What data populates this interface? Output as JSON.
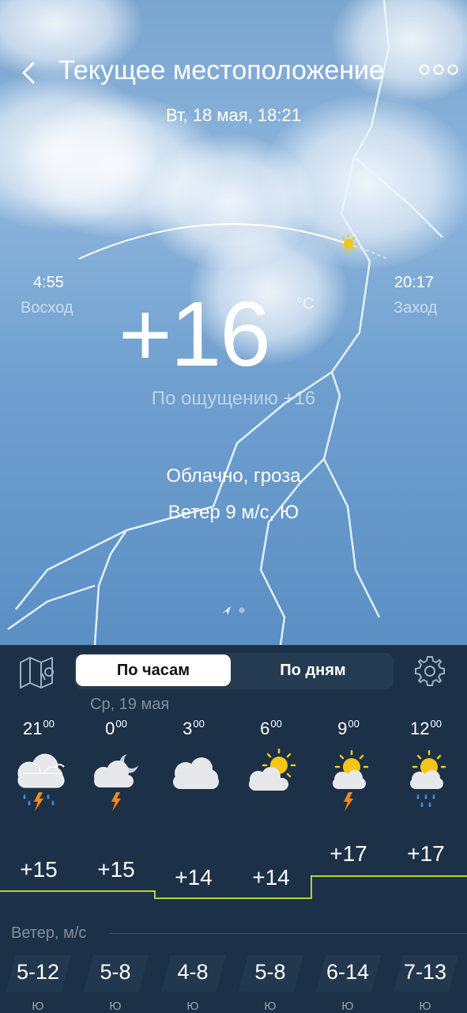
{
  "header": {
    "title": "Текущее местоположение",
    "date": "Вт, 18 мая, 18:21"
  },
  "sun": {
    "sunrise_time": "4:55",
    "sunrise_label": "Восход",
    "sunset_time": "20:17",
    "sunset_label": "Заход"
  },
  "current": {
    "temperature": "+16",
    "unit": "°C",
    "feels_like": "По ощущению +16",
    "condition": "Облачно, гроза",
    "wind": "Ветер 9 м/с, Ю"
  },
  "tabs": {
    "hourly": "По часам",
    "daily": "По дням"
  },
  "forecast": {
    "day_label": "Ср, 19 мая",
    "hours": [
      {
        "hour": "21",
        "min": "00",
        "icon": "cloud-thunder-rain-icon",
        "temp": "+15",
        "wind": "5-12",
        "dir": "Ю"
      },
      {
        "hour": "0",
        "min": "00",
        "icon": "night-cloud-thunder-icon",
        "temp": "+15",
        "wind": "5-8",
        "dir": "Ю"
      },
      {
        "hour": "3",
        "min": "00",
        "icon": "cloudy-icon",
        "temp": "+14",
        "wind": "4-8",
        "dir": "Ю"
      },
      {
        "hour": "6",
        "min": "00",
        "icon": "partly-cloudy-icon",
        "temp": "+14",
        "wind": "5-8",
        "dir": "Ю"
      },
      {
        "hour": "9",
        "min": "00",
        "icon": "sun-cloud-thunder-icon",
        "temp": "+17",
        "wind": "6-14",
        "dir": "Ю"
      },
      {
        "hour": "12",
        "min": "00",
        "icon": "sun-cloud-rain-icon",
        "temp": "+17",
        "wind": "7-13",
        "dir": "Ю"
      }
    ],
    "wind_title": "Ветер, м/с"
  },
  "colors": {
    "temp_line": "#b5d334",
    "rain": "#3a8fe0",
    "bolt": "#f08a1c",
    "sun": "#f5c518"
  }
}
